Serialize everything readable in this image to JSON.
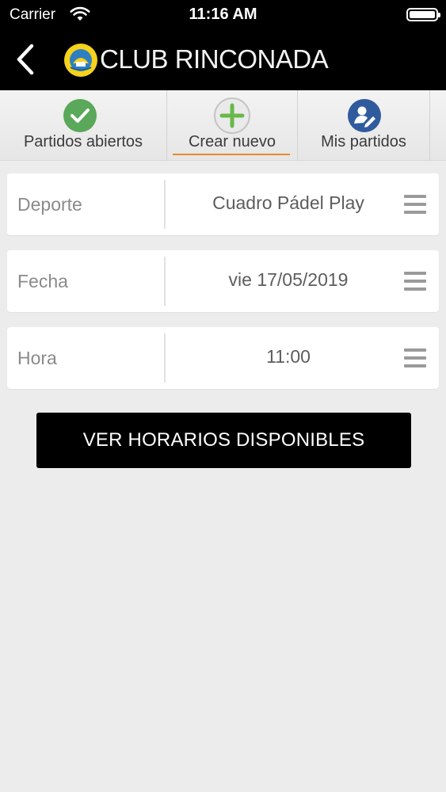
{
  "status_bar": {
    "carrier": "Carrier",
    "time": "11:16 AM",
    "wifi_icon": "wifi-icon",
    "battery_icon": "battery-icon"
  },
  "navbar": {
    "back_icon": "chevron-left-icon",
    "logo_icon": "club-logo-icon",
    "brand_text": "CLUB RINCONADA"
  },
  "tabs": [
    {
      "label": "Partidos abiertos",
      "icon": "check-circle-icon",
      "icon_color": "#5aa85a",
      "active": false
    },
    {
      "label": "Crear nuevo",
      "icon": "plus-circle-icon",
      "icon_color": "#6ab84a",
      "active": true
    },
    {
      "label": "Mis partidos",
      "icon": "user-edit-icon",
      "icon_color": "#2f5b9e",
      "active": false
    }
  ],
  "fields": [
    {
      "label": "Deporte",
      "value": "Cuadro Pádel Play",
      "menu_icon": "menu-icon"
    },
    {
      "label": "Fecha",
      "value": "vie 17/05/2019",
      "menu_icon": "menu-icon"
    },
    {
      "label": "Hora",
      "value": "11:00",
      "menu_icon": "menu-icon"
    }
  ],
  "primary_button": {
    "label": "VER HORARIOS DISPONIBLES"
  },
  "colors": {
    "accent_underline": "#e58a2b",
    "header_bg": "#000000",
    "page_bg": "#ececec"
  }
}
